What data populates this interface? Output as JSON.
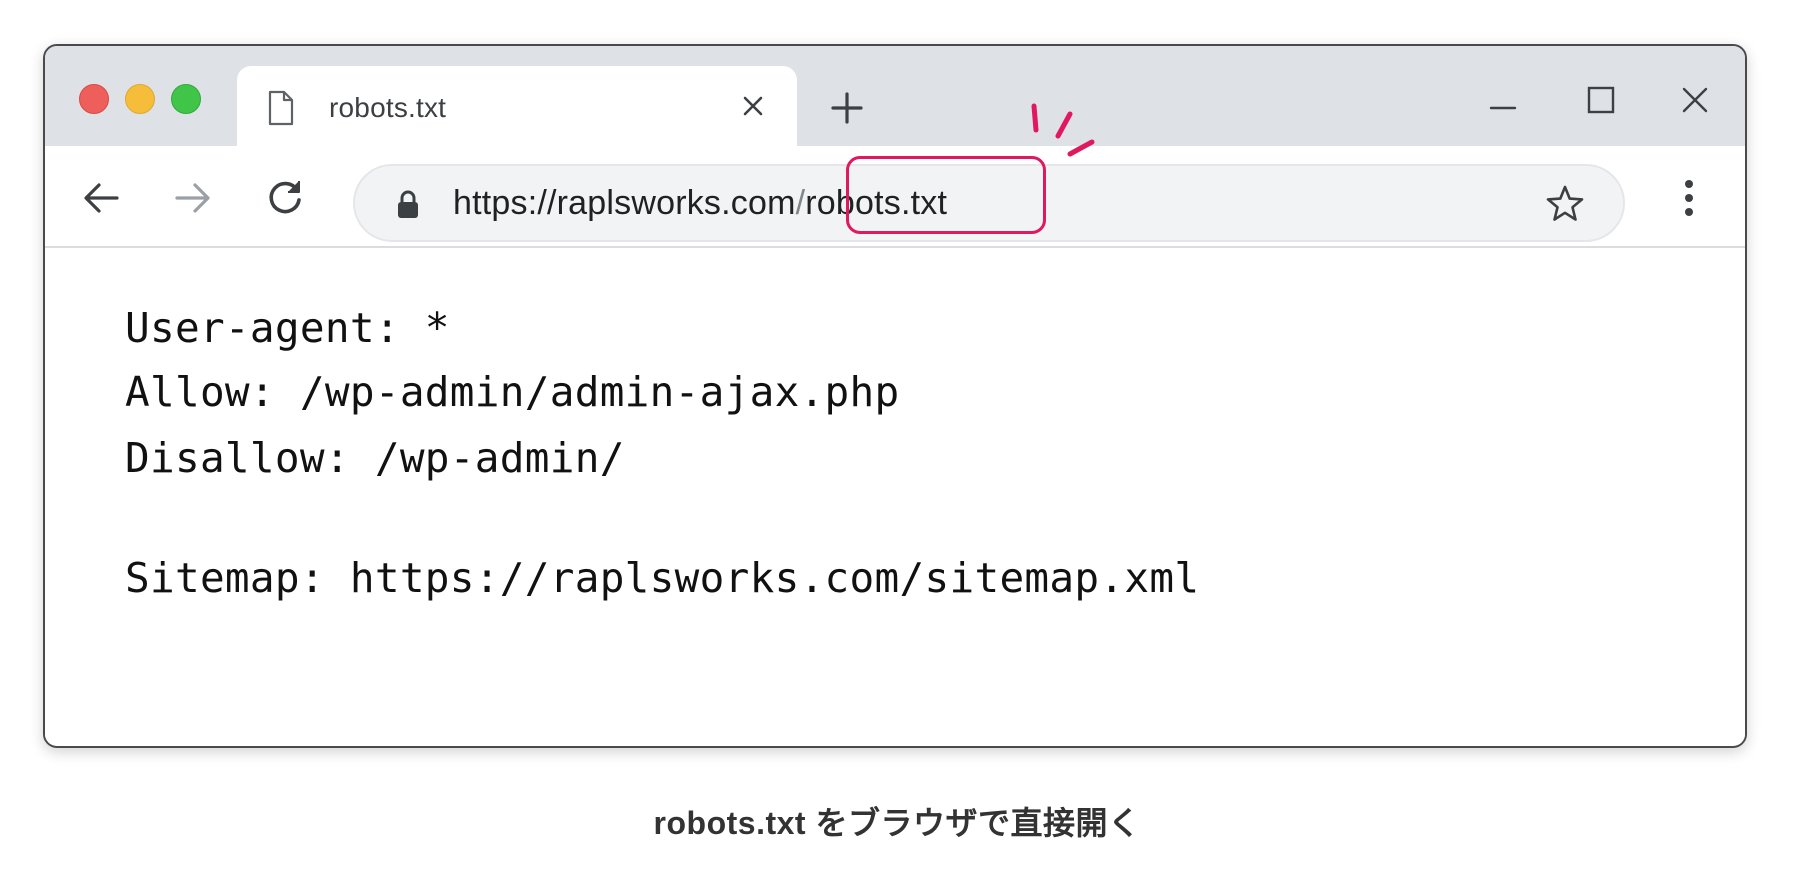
{
  "browser": {
    "tab": {
      "title": "robots.txt",
      "file_icon": "document-icon",
      "close_icon": "close-icon"
    },
    "new_tab_icon": "plus-icon",
    "window_controls": [
      "minimize-icon",
      "maximize-icon",
      "close-icon"
    ],
    "traffic_lights": {
      "red": "#ee5f5b",
      "yellow": "#f6bd3b",
      "green": "#40c548"
    },
    "toolbar": {
      "back_icon": "arrow-left-icon",
      "forward_icon": "arrow-right-icon",
      "reload_icon": "reload-icon",
      "menu_icon": "kebab-menu-icon"
    },
    "address_bar": {
      "lock_icon": "lock-icon",
      "scheme": "https://",
      "domain": "raplsworks.com",
      "separator": "/",
      "path": "robots.txt",
      "bookmark_icon": "star-icon",
      "highlight_color": "#e0185f"
    }
  },
  "robots_file": {
    "lines": [
      "User-agent: *",
      "Allow: /wp-admin/admin-ajax.php",
      "Disallow: /wp-admin/",
      "",
      "Sitemap: https://raplsworks.com/sitemap.xml"
    ]
  },
  "caption": "robots.txt をブラウザで直接開く"
}
